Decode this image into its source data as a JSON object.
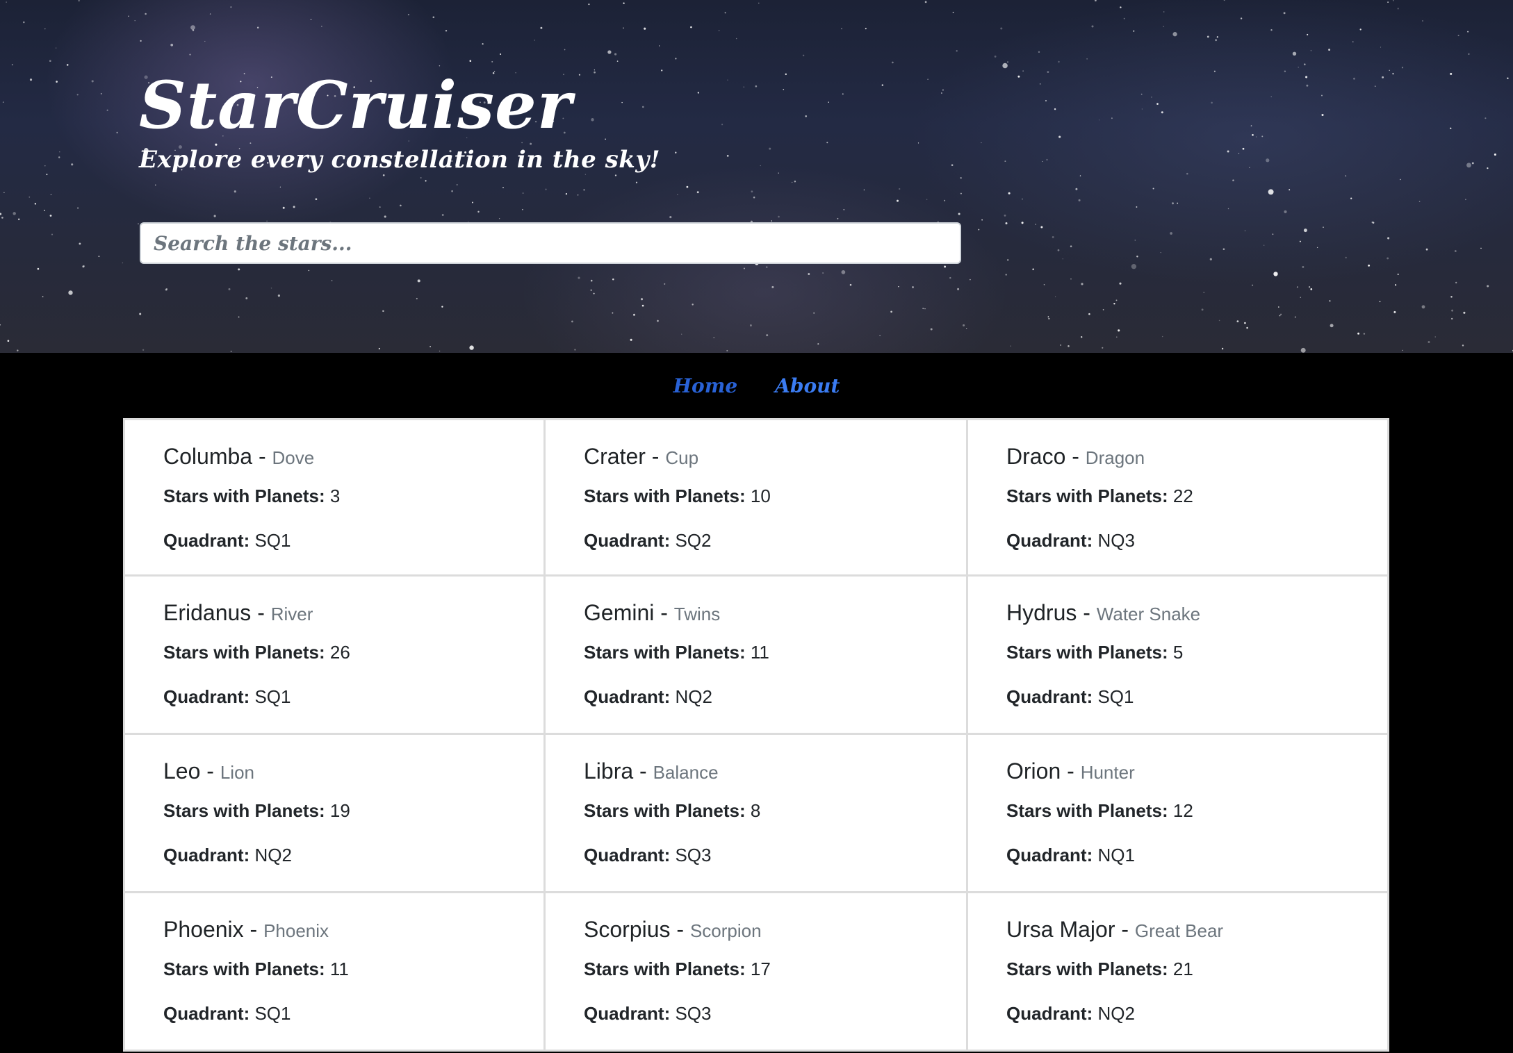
{
  "header": {
    "title": "StarCruiser",
    "subtitle": "Explore every constellation in the sky!",
    "search_placeholder": "Search the stars..."
  },
  "nav": {
    "items": [
      {
        "label": "Home"
      },
      {
        "label": "About"
      }
    ]
  },
  "labels": {
    "planets": "Stars with Planets:",
    "quadrant": "Quadrant:",
    "dash": " - "
  },
  "constellations": [
    {
      "name": "Columba",
      "alias": "Dove",
      "planets": "3",
      "quadrant": "SQ1"
    },
    {
      "name": "Crater",
      "alias": "Cup",
      "planets": "10",
      "quadrant": "SQ2"
    },
    {
      "name": "Draco",
      "alias": "Dragon",
      "planets": "22",
      "quadrant": "NQ3"
    },
    {
      "name": "Eridanus",
      "alias": "River",
      "planets": "26",
      "quadrant": "SQ1"
    },
    {
      "name": "Gemini",
      "alias": "Twins",
      "planets": "11",
      "quadrant": "NQ2"
    },
    {
      "name": "Hydrus",
      "alias": "Water Snake",
      "planets": "5",
      "quadrant": "SQ1"
    },
    {
      "name": "Leo",
      "alias": "Lion",
      "planets": "19",
      "quadrant": "NQ2"
    },
    {
      "name": "Libra",
      "alias": "Balance",
      "planets": "8",
      "quadrant": "SQ3"
    },
    {
      "name": "Orion",
      "alias": "Hunter",
      "planets": "12",
      "quadrant": "NQ1"
    },
    {
      "name": "Phoenix",
      "alias": "Phoenix",
      "planets": "11",
      "quadrant": "SQ1"
    },
    {
      "name": "Scorpius",
      "alias": "Scorpion",
      "planets": "17",
      "quadrant": "SQ3"
    },
    {
      "name": "Ursa Major",
      "alias": "Great Bear",
      "planets": "21",
      "quadrant": "NQ2"
    }
  ],
  "colors": {
    "nav_home": "#2962d6",
    "nav_about": "#3b7cf2",
    "alias_text": "#6c757d"
  }
}
